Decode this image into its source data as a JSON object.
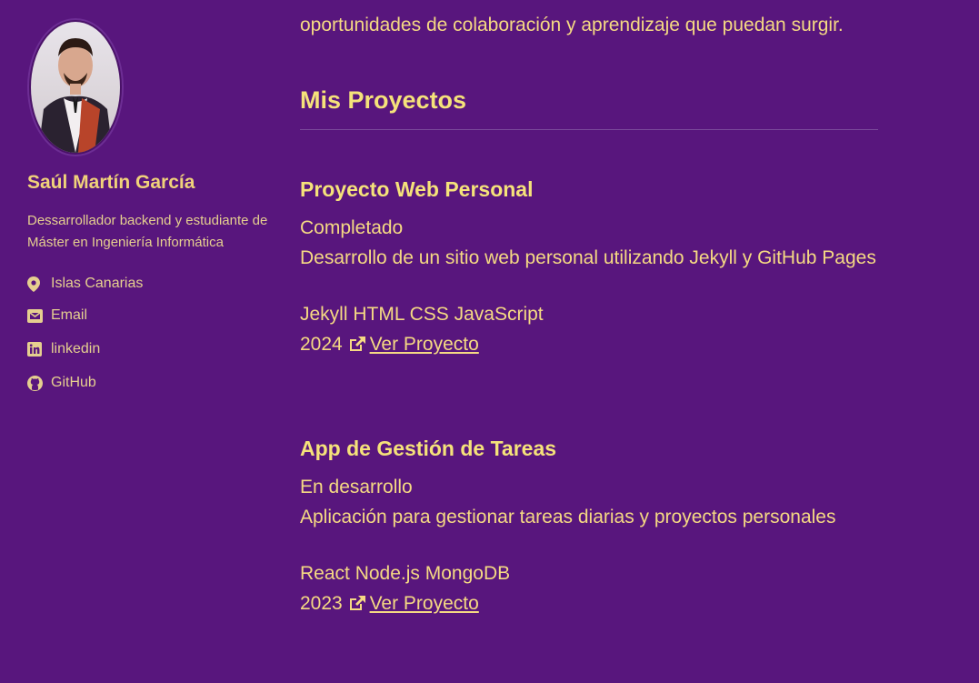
{
  "sidebar": {
    "name": "Saúl Martín García",
    "bio": "Dessarrollador backend y estudiante de Máster en Ingeniería Informática",
    "links": [
      {
        "label": "Islas Canarias",
        "icon": "location-pin-icon"
      },
      {
        "label": "Email",
        "icon": "envelope-icon"
      },
      {
        "label": "linkedin",
        "icon": "linkedin-icon"
      },
      {
        "label": "GitHub",
        "icon": "github-icon"
      }
    ]
  },
  "main": {
    "intro_tail": "p ... oportunidades de colaboración y aprendizaje que puedan surgir.",
    "intro_line": "oportunidades de colaboración y aprendizaje que puedan surgir.",
    "section_title": "Mis Proyectos",
    "projects": [
      {
        "title": "Proyecto Web Personal",
        "status": "Completado",
        "description": "Desarrollo de un sitio web personal utilizando Jekyll y GitHub Pages",
        "tech": "Jekyll HTML CSS JavaScript",
        "year": "2024",
        "link_label": "Ver Proyecto"
      },
      {
        "title": "App de Gestión de Tareas",
        "status": "En desarrollo",
        "description": "Aplicación para gestionar tareas diarias y proyectos personales",
        "tech": "React Node.js MongoDB",
        "year": "2023",
        "link_label": "Ver Proyecto"
      }
    ]
  },
  "colors": {
    "background": "#58167d",
    "accent": "#f5e27a",
    "text": "#f5d983"
  }
}
